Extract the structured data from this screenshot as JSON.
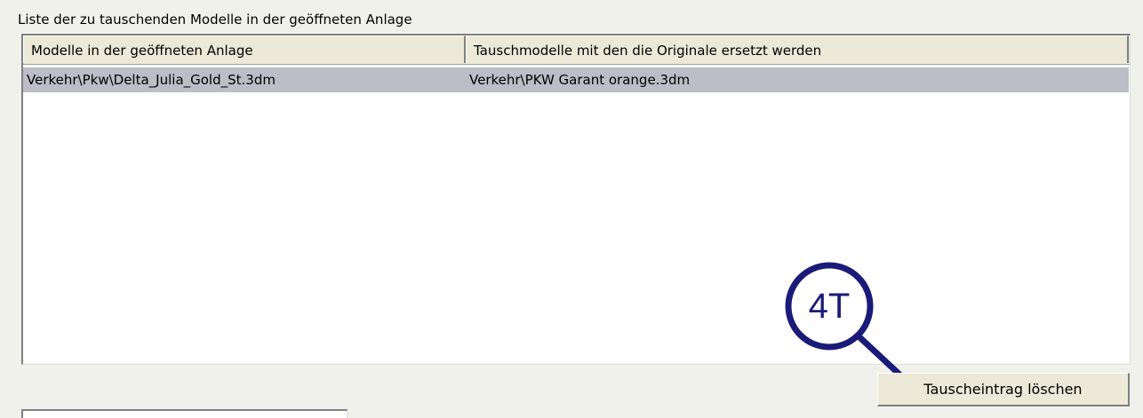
{
  "group": {
    "label": "Liste der zu tauschenden Modelle in der geöffneten Anlage"
  },
  "list": {
    "columns": [
      "Modelle in der geöffneten Anlage",
      "Tauschmodelle mit den die Originale ersetzt werden"
    ],
    "rows": [
      {
        "original": "Verkehr\\Pkw\\Delta_Julia_Gold_St.3dm",
        "replacement": "Verkehr\\PKW Garant orange.3dm",
        "selected": true
      }
    ]
  },
  "callout": {
    "label": "4T",
    "color": "#1a1a78"
  },
  "buttons": {
    "delete_entry": "Tauscheintrag löschen"
  },
  "colors": {
    "background": "#f1f1ec",
    "selected_row": "#bdbdc7",
    "header": "#ece9d8"
  }
}
